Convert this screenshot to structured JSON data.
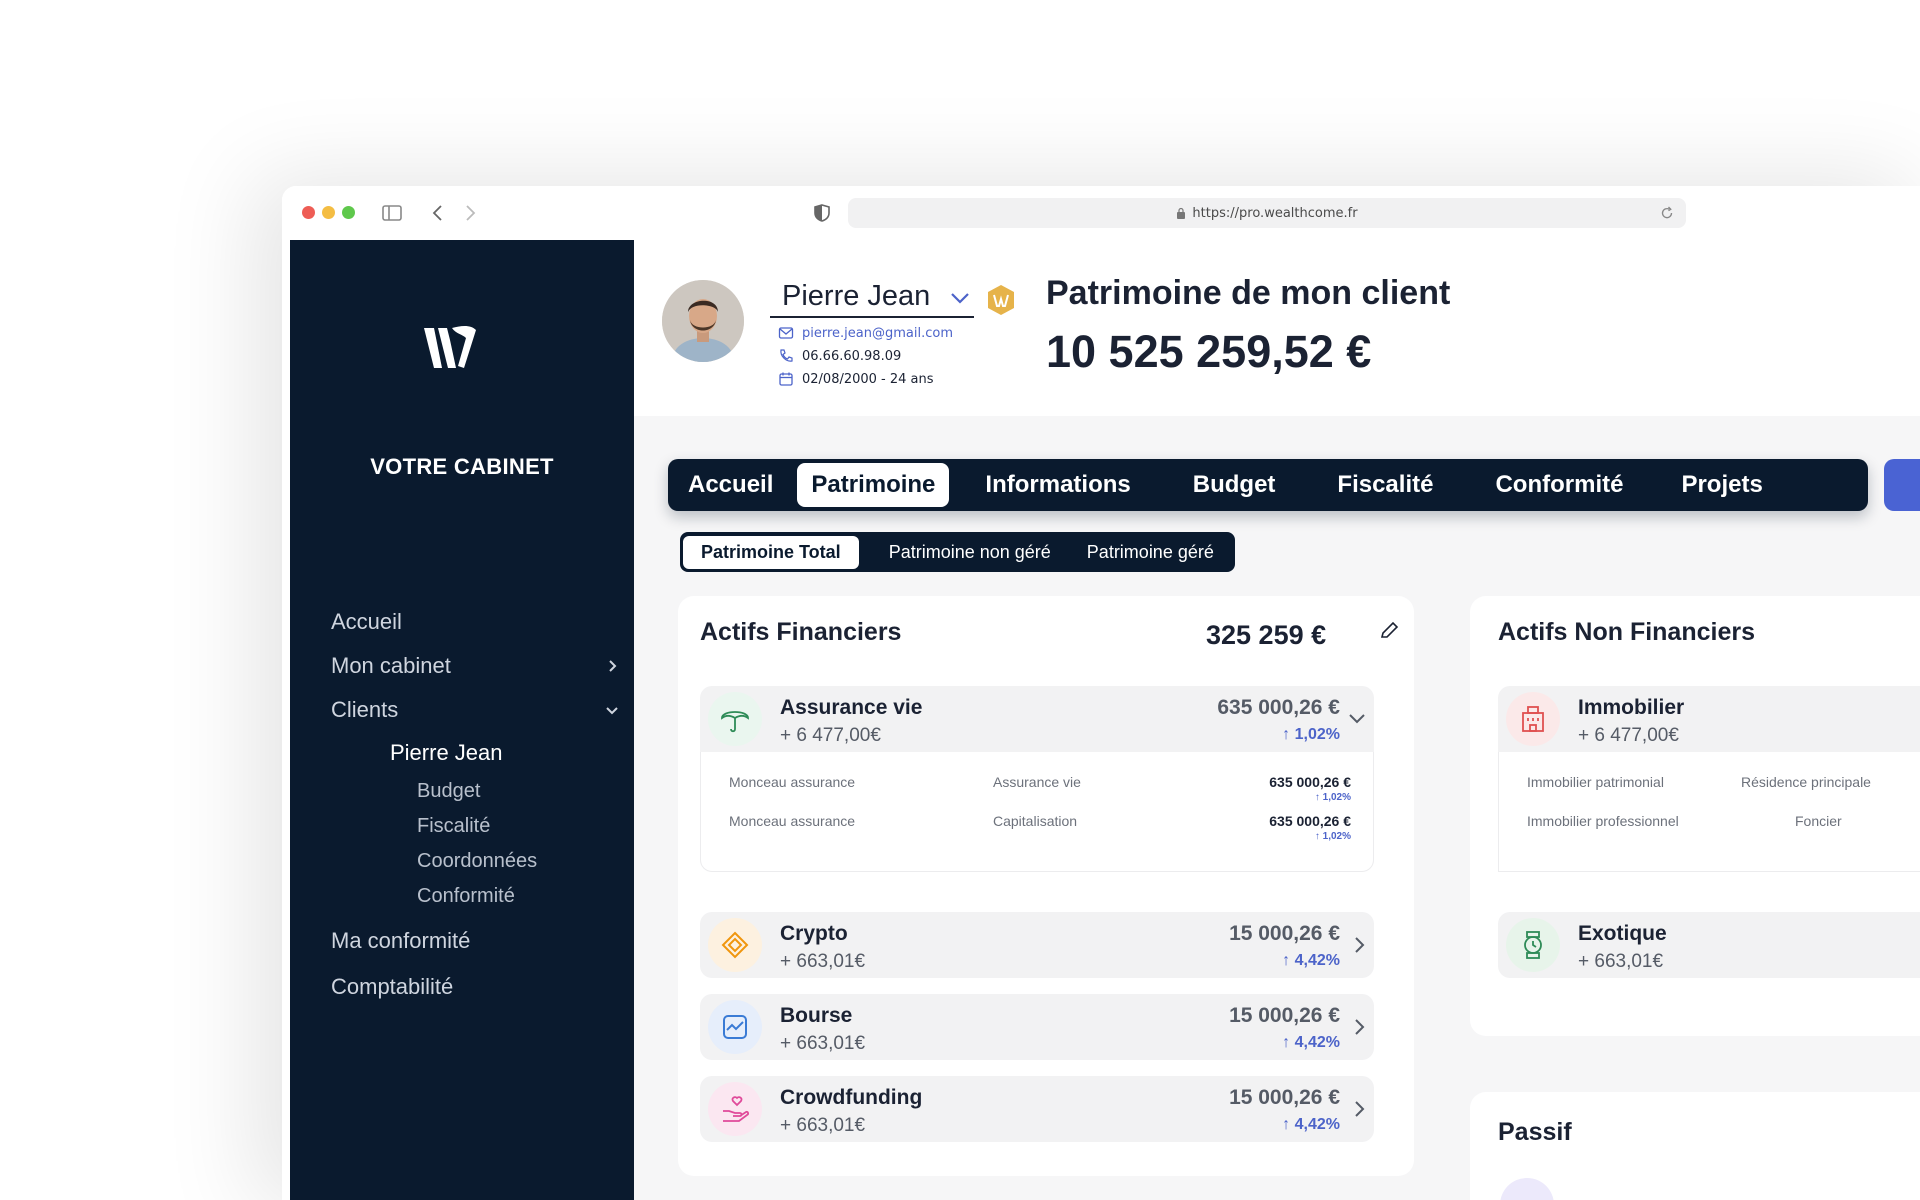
{
  "browser": {
    "url": "https://pro.wealthcome.fr"
  },
  "sidebar": {
    "cabinet_label": "VOTRE CABINET",
    "items": [
      {
        "label": "Accueil"
      },
      {
        "label": "Mon cabinet"
      },
      {
        "label": "Clients"
      }
    ],
    "client": "Pierre Jean",
    "client_subitems": [
      "Budget",
      "Fiscalité",
      "Coordonnées",
      "Conformité"
    ],
    "bottom_items": [
      "Ma conformité",
      "Comptabilité"
    ]
  },
  "header": {
    "client_name": "Pierre Jean",
    "email": "pierre.jean@gmail.com",
    "phone": "06.66.60.98.09",
    "birth": "02/08/2000 - 24 ans",
    "title": "Patrimoine de mon client",
    "total": "10 525 259,52 €"
  },
  "tabs": [
    "Accueil",
    "Patrimoine",
    "Informations",
    "Budget",
    "Fiscalité",
    "Conformité",
    "Projets"
  ],
  "active_tab": "Patrimoine",
  "subtabs": [
    "Patrimoine Total",
    "Patrimoine non géré",
    "Patrimoine géré"
  ],
  "active_subtab": "Patrimoine Total",
  "financial": {
    "title": "Actifs Financiers",
    "total": "325 259 €",
    "assets": [
      {
        "name": "Assurance vie",
        "gain": "+ 6 477,00€",
        "value": "635 000,26 €",
        "pct": "1,02%",
        "icon": "umbrella-icon",
        "color": "#2e8b57"
      },
      {
        "name": "Crypto",
        "gain": "+ 663,01€",
        "value": "15 000,26 €",
        "pct": "4,42%",
        "icon": "crypto-icon",
        "color": "#f0960e"
      },
      {
        "name": "Bourse",
        "gain": "+ 663,01€",
        "value": "15 000,26 €",
        "pct": "4,42%",
        "icon": "chart-icon",
        "color": "#3a7bd5"
      },
      {
        "name": "Crowdfunding",
        "gain": "+ 663,01€",
        "value": "15 000,26 €",
        "pct": "4,42%",
        "icon": "hand-heart-icon",
        "color": "#e04a9a"
      }
    ],
    "details": [
      {
        "provider": "Monceau assurance",
        "type": "Assurance vie",
        "value": "635 000,26 €",
        "pct": "1,02%"
      },
      {
        "provider": "Monceau assurance",
        "type": "Capitalisation",
        "value": "635 000,26 €",
        "pct": "1,02%"
      }
    ]
  },
  "nonfinancial": {
    "title": "Actifs Non Financiers",
    "assets": [
      {
        "name": "Immobilier",
        "gain": "+ 6 477,00€",
        "icon": "building-icon",
        "color": "#e05050"
      },
      {
        "name": "Exotique",
        "gain": "+ 663,01€",
        "icon": "watch-icon",
        "color": "#2e8b57"
      }
    ],
    "details": [
      {
        "label": "Immobilier patrimonial",
        "type": "Résidence principale"
      },
      {
        "label": "Immobilier professionnel",
        "type": "Foncier"
      }
    ]
  },
  "passif": {
    "title": "Passif"
  }
}
